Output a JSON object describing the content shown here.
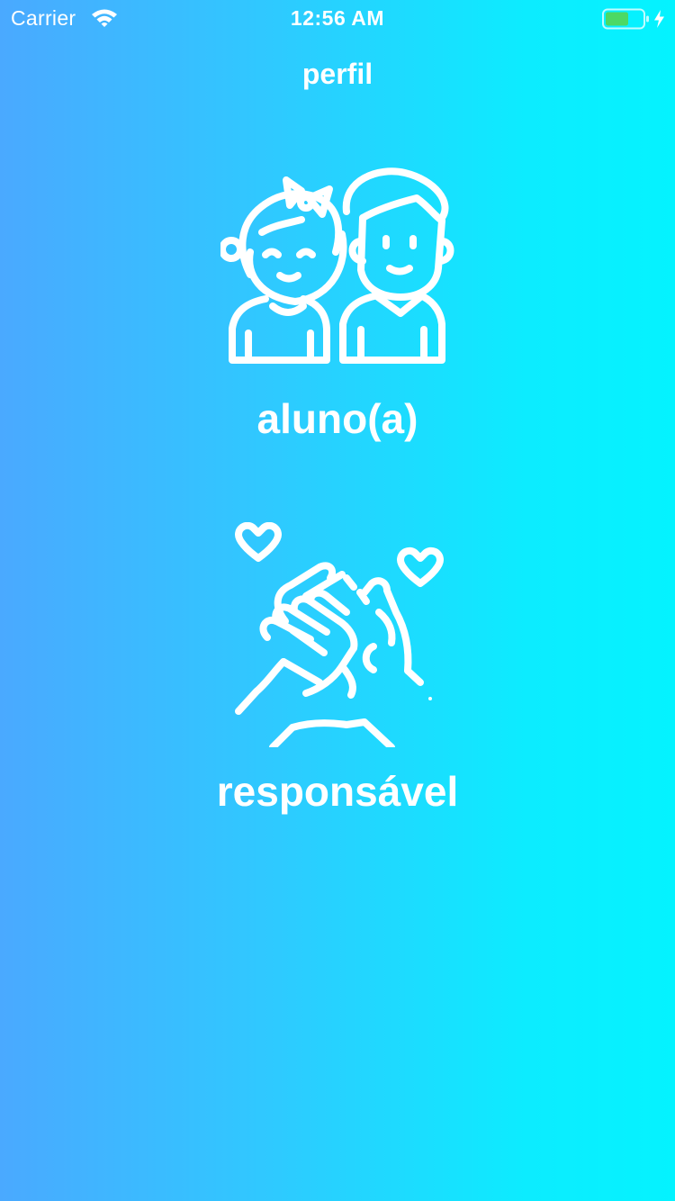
{
  "status_bar": {
    "carrier": "Carrier",
    "time": "12:56 AM",
    "wifi_icon": "wifi-icon",
    "battery_icon": "battery-charging-icon",
    "battery_color": "#4cd964"
  },
  "header": {
    "title": "perfil"
  },
  "options": [
    {
      "label": "aluno(a)",
      "icon": "children-icon"
    },
    {
      "label": "responsável",
      "icon": "holding-hands-hearts-icon"
    }
  ],
  "colors": {
    "gradient_start": "#4aa9ff",
    "gradient_end": "#04f3ff",
    "foreground": "#ffffff"
  }
}
